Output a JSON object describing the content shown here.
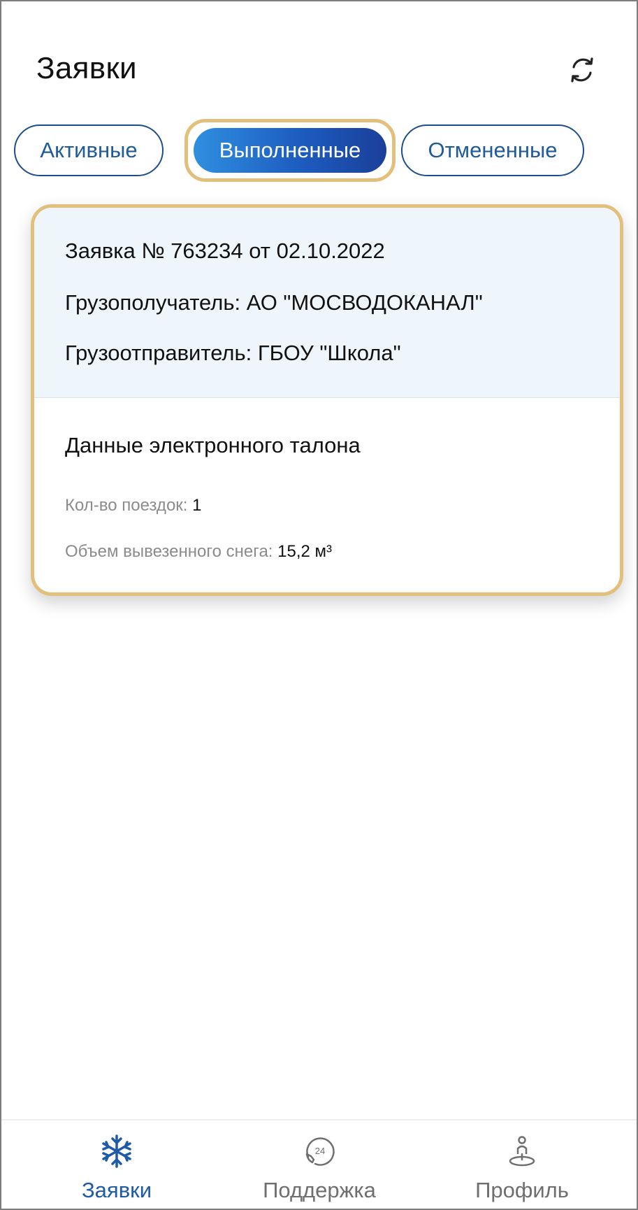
{
  "header": {
    "title": "Заявки",
    "refresh_icon": "refresh-icon"
  },
  "tabs": {
    "active": "Активные",
    "completed": "Выполненные",
    "cancelled": "Отмененные",
    "selected": "Выполненные"
  },
  "card": {
    "title": "Заявка № 763234 от 02.10.2022",
    "consignee": "Грузополучатель: АО \"МОСВОДОКАНАЛ\"",
    "shipper": "Грузоотправитель: ГБОУ \"Школа\"",
    "section_title": "Данные электронного талона",
    "trips_label": "Кол-во поездок: ",
    "trips_value": "1",
    "snow_label": "Объем вывезенного снега: ",
    "snow_value": "15,2 м³"
  },
  "bottom_nav": {
    "items": [
      {
        "label": "Заявки",
        "icon": "snowflake-icon",
        "active": true
      },
      {
        "label": "Поддержка",
        "icon": "support-24-icon",
        "active": false
      },
      {
        "label": "Профиль",
        "icon": "profile-pin-icon",
        "active": false
      }
    ]
  },
  "colors": {
    "accent": "#1e5aa7",
    "highlight": "#e3bf7c",
    "card_header_bg": "#eef6fc",
    "tab_border": "#1e4f8c",
    "inactive_nav": "#6f6f6f"
  }
}
